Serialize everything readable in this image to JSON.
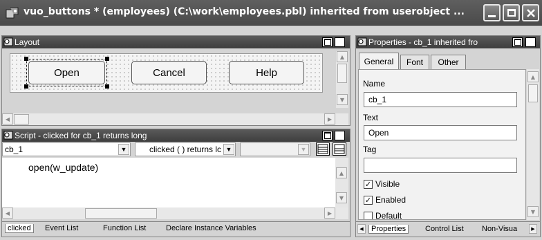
{
  "window": {
    "title": "vuo_buttons * (employees) (C:\\work\\employees.pbl) inherited from userobject ...",
    "icon": "app-icon",
    "controls": [
      "minimize-icon",
      "maximize-icon",
      "close-icon"
    ]
  },
  "layout_pane": {
    "title": "Layout",
    "buttons": [
      {
        "label": "Open",
        "selected": true
      },
      {
        "label": "Cancel",
        "selected": false
      },
      {
        "label": "Help",
        "selected": false
      }
    ]
  },
  "script_pane": {
    "title": "Script - clicked for cb_1 returns long",
    "object_select": "cb_1",
    "event_select": "clicked ( )  returns lc",
    "code": "open(w_update)",
    "tabs": [
      "clicked",
      "Event List",
      "Function List",
      "Declare Instance Variables"
    ]
  },
  "properties_pane": {
    "title": "Properties - cb_1 inherited fro",
    "tabs": [
      "General",
      "Font",
      "Other"
    ],
    "active_tab": "General",
    "fields": [
      {
        "label": "Name",
        "value": "cb_1"
      },
      {
        "label": "Text",
        "value": "Open"
      },
      {
        "label": "Tag",
        "value": ""
      }
    ],
    "checkboxes": [
      {
        "label": "Visible",
        "checked": true
      },
      {
        "label": "Enabled",
        "checked": true
      },
      {
        "label": "Default",
        "checked": false
      }
    ],
    "bottom_tabs": [
      "Properties",
      "Control List",
      "Non-Visua"
    ]
  }
}
